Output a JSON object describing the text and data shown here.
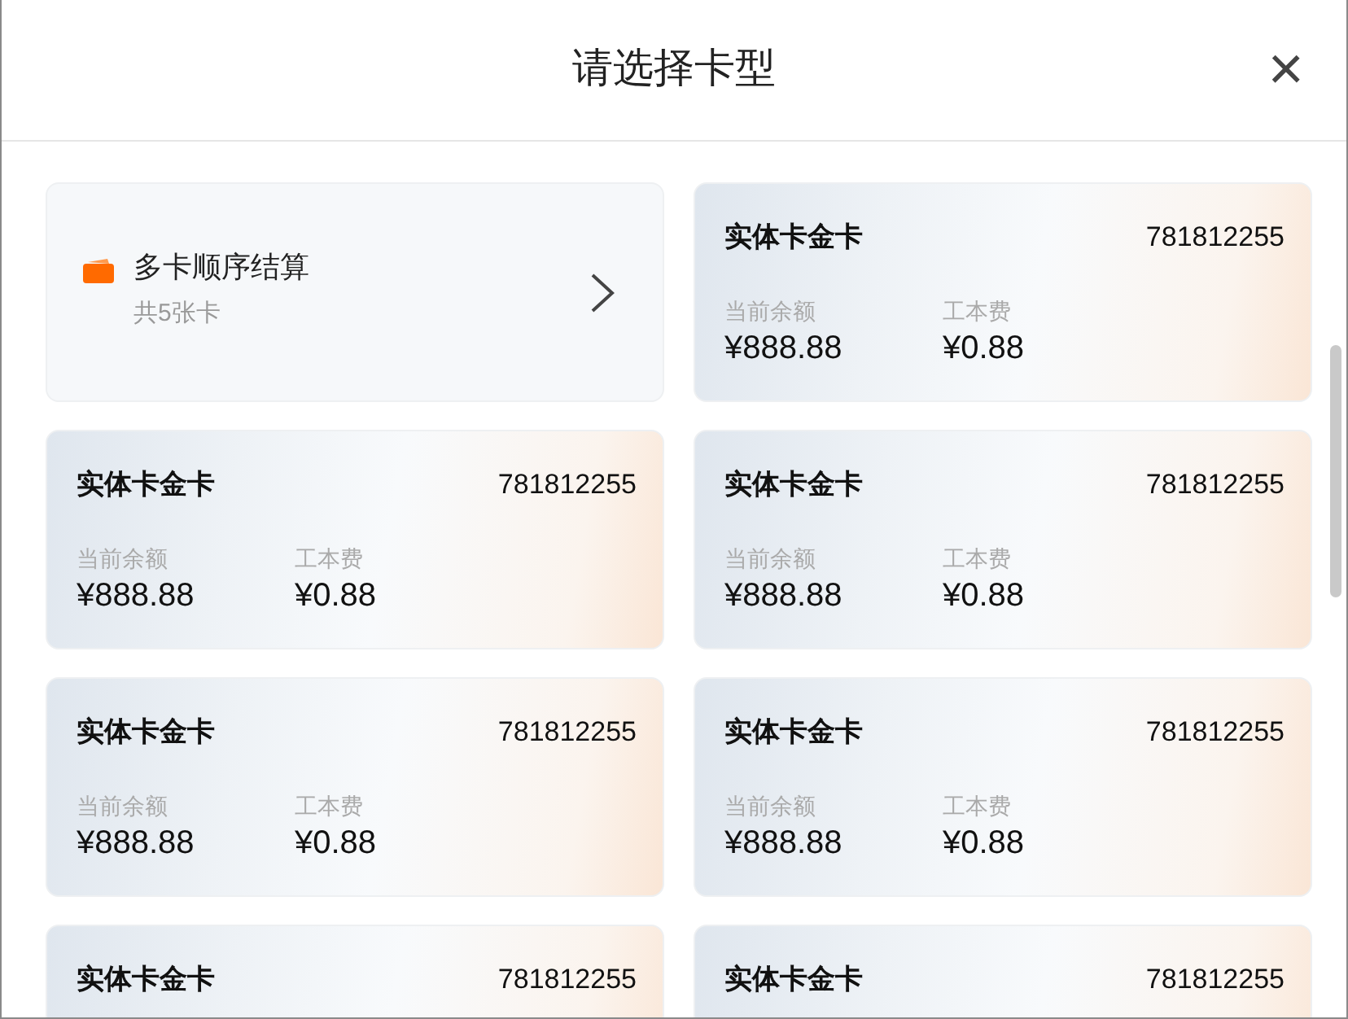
{
  "dialog": {
    "title": "请选择卡型",
    "close": "×"
  },
  "multi_card": {
    "title": "多卡顺序结算",
    "subtitle": "共5张卡"
  },
  "cards": [
    {
      "name": "实体卡金卡",
      "number": "781812255",
      "balance_label": "当前余额",
      "balance": "¥888.88",
      "fee_label": "工本费",
      "fee": "¥0.88"
    },
    {
      "name": "实体卡金卡",
      "number": "781812255",
      "balance_label": "当前余额",
      "balance": "¥888.88",
      "fee_label": "工本费",
      "fee": "¥0.88"
    },
    {
      "name": "实体卡金卡",
      "number": "781812255",
      "balance_label": "当前余额",
      "balance": "¥888.88",
      "fee_label": "工本费",
      "fee": "¥0.88"
    },
    {
      "name": "实体卡金卡",
      "number": "781812255",
      "balance_label": "当前余额",
      "balance": "¥888.88",
      "fee_label": "工本费",
      "fee": "¥0.88"
    },
    {
      "name": "实体卡金卡",
      "number": "781812255",
      "balance_label": "当前余额",
      "balance": "¥888.88",
      "fee_label": "工本费",
      "fee": "¥0.88"
    },
    {
      "name": "实体卡金卡",
      "number": "781812255"
    },
    {
      "name": "实体卡金卡",
      "number": "781812255"
    }
  ]
}
